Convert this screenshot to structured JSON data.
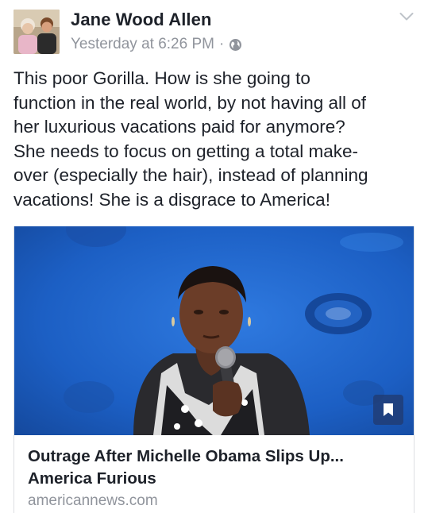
{
  "post": {
    "author_name": "Jane Wood Allen",
    "timestamp": "Yesterday at 6:26 PM",
    "separator": "·",
    "privacy_icon": "globe-icon",
    "menu_icon": "chevron-down-icon",
    "text_lines": [
      "This poor Gorilla. How is she going to",
      "function in the real world, by not having all of",
      "her luxurious vacations paid for anymore?",
      "She needs to focus on getting a total make-",
      "over (especially the hair), instead of planning",
      "vacations! She is a disgrace to America!"
    ]
  },
  "link": {
    "title_lines": [
      "Outrage After Michelle Obama Slips Up...",
      "America Furious"
    ],
    "domain": "americannews.com",
    "save_icon": "bookmark-icon"
  },
  "colors": {
    "text": "#1d2129",
    "secondary": "#90949c",
    "image_blue": "#1d63c8"
  }
}
